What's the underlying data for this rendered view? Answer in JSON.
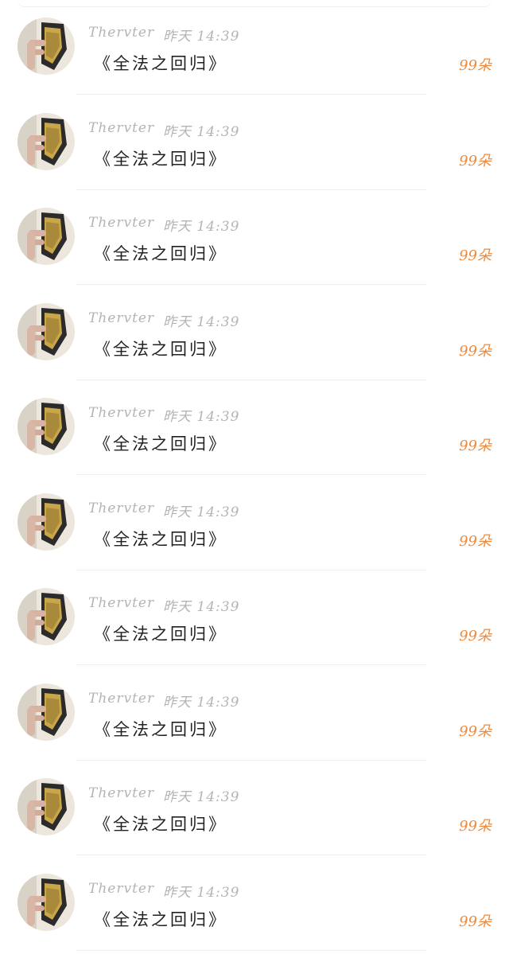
{
  "theme": {
    "username_color": "#b4b4b4",
    "title_color": "#222222",
    "count_color": "#ee8a3c"
  },
  "items": [
    {
      "avatar": "user-avatar-icon",
      "username": "Thervter",
      "time": "昨天 14:39",
      "title": "《全法之回归》",
      "count": "99朵"
    },
    {
      "avatar": "user-avatar-icon",
      "username": "Thervter",
      "time": "昨天 14:39",
      "title": "《全法之回归》",
      "count": "99朵"
    },
    {
      "avatar": "user-avatar-icon",
      "username": "Thervter",
      "time": "昨天 14:39",
      "title": "《全法之回归》",
      "count": "99朵"
    },
    {
      "avatar": "user-avatar-icon",
      "username": "Thervter",
      "time": "昨天 14:39",
      "title": "《全法之回归》",
      "count": "99朵"
    },
    {
      "avatar": "user-avatar-icon",
      "username": "Thervter",
      "time": "昨天 14:39",
      "title": "《全法之回归》",
      "count": "99朵"
    },
    {
      "avatar": "user-avatar-icon",
      "username": "Thervter",
      "time": "昨天 14:39",
      "title": "《全法之回归》",
      "count": "99朵"
    },
    {
      "avatar": "user-avatar-icon",
      "username": "Thervter",
      "time": "昨天 14:39",
      "title": "《全法之回归》",
      "count": "99朵"
    },
    {
      "avatar": "user-avatar-icon",
      "username": "Thervter",
      "time": "昨天 14:39",
      "title": "《全法之回归》",
      "count": "99朵"
    },
    {
      "avatar": "user-avatar-icon",
      "username": "Thervter",
      "time": "昨天 14:39",
      "title": "《全法之回归》",
      "count": "99朵"
    },
    {
      "avatar": "user-avatar-icon",
      "username": "Thervter",
      "time": "昨天 14:39",
      "title": "《全法之回归》",
      "count": "99朵"
    }
  ]
}
